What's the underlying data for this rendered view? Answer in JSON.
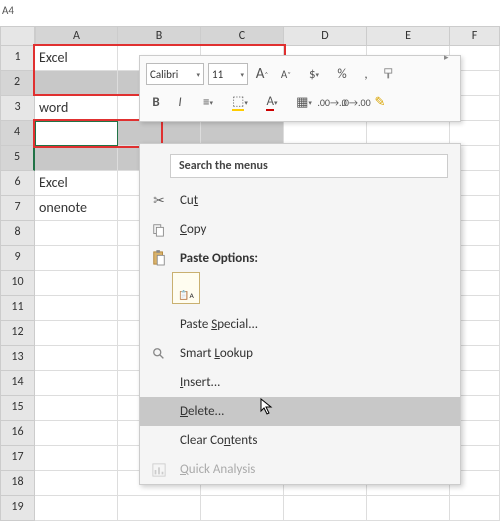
{
  "namebox": "A4",
  "columns": [
    "A",
    "B",
    "C",
    "D",
    "E",
    "F"
  ],
  "selected_cols": [
    "A",
    "B",
    "C"
  ],
  "rows": [
    {
      "n": 1,
      "a": "Excel"
    },
    {
      "n": 2,
      "a": "",
      "sel": true
    },
    {
      "n": 3,
      "a": "word"
    },
    {
      "n": 4,
      "a": "",
      "sel": true,
      "active": true
    },
    {
      "n": 5,
      "a": "",
      "sel": true
    },
    {
      "n": 6,
      "a": "Excel"
    },
    {
      "n": 7,
      "a": "onenote"
    },
    {
      "n": 8,
      "a": ""
    },
    {
      "n": 9,
      "a": ""
    },
    {
      "n": 10,
      "a": ""
    },
    {
      "n": 11,
      "a": ""
    },
    {
      "n": 12,
      "a": ""
    },
    {
      "n": 13,
      "a": ""
    },
    {
      "n": 14,
      "a": ""
    },
    {
      "n": 15,
      "a": ""
    },
    {
      "n": 16,
      "a": ""
    },
    {
      "n": 17,
      "a": ""
    },
    {
      "n": 18,
      "a": ""
    },
    {
      "n": 19,
      "a": ""
    }
  ],
  "mini_toolbar": {
    "font": "Calibri",
    "size": "11",
    "grow": "A",
    "shrink": "A",
    "bold": "B",
    "italic": "I",
    "percent": "%",
    "comma": ",",
    "currency": "$",
    "font_color": "A",
    "highlighter": "✎"
  },
  "ctx": {
    "search_placeholder": "Search the menus",
    "cut": "Cut",
    "copy": "Copy",
    "paste_heading": "Paste Options:",
    "paste_icon_label": "A",
    "paste_special": "Paste Special...",
    "smart_lookup": "Smart Lookup",
    "insert": "Insert...",
    "delete": "Delete...",
    "clear": "Clear Contents",
    "quick": "Quick Analysis"
  }
}
